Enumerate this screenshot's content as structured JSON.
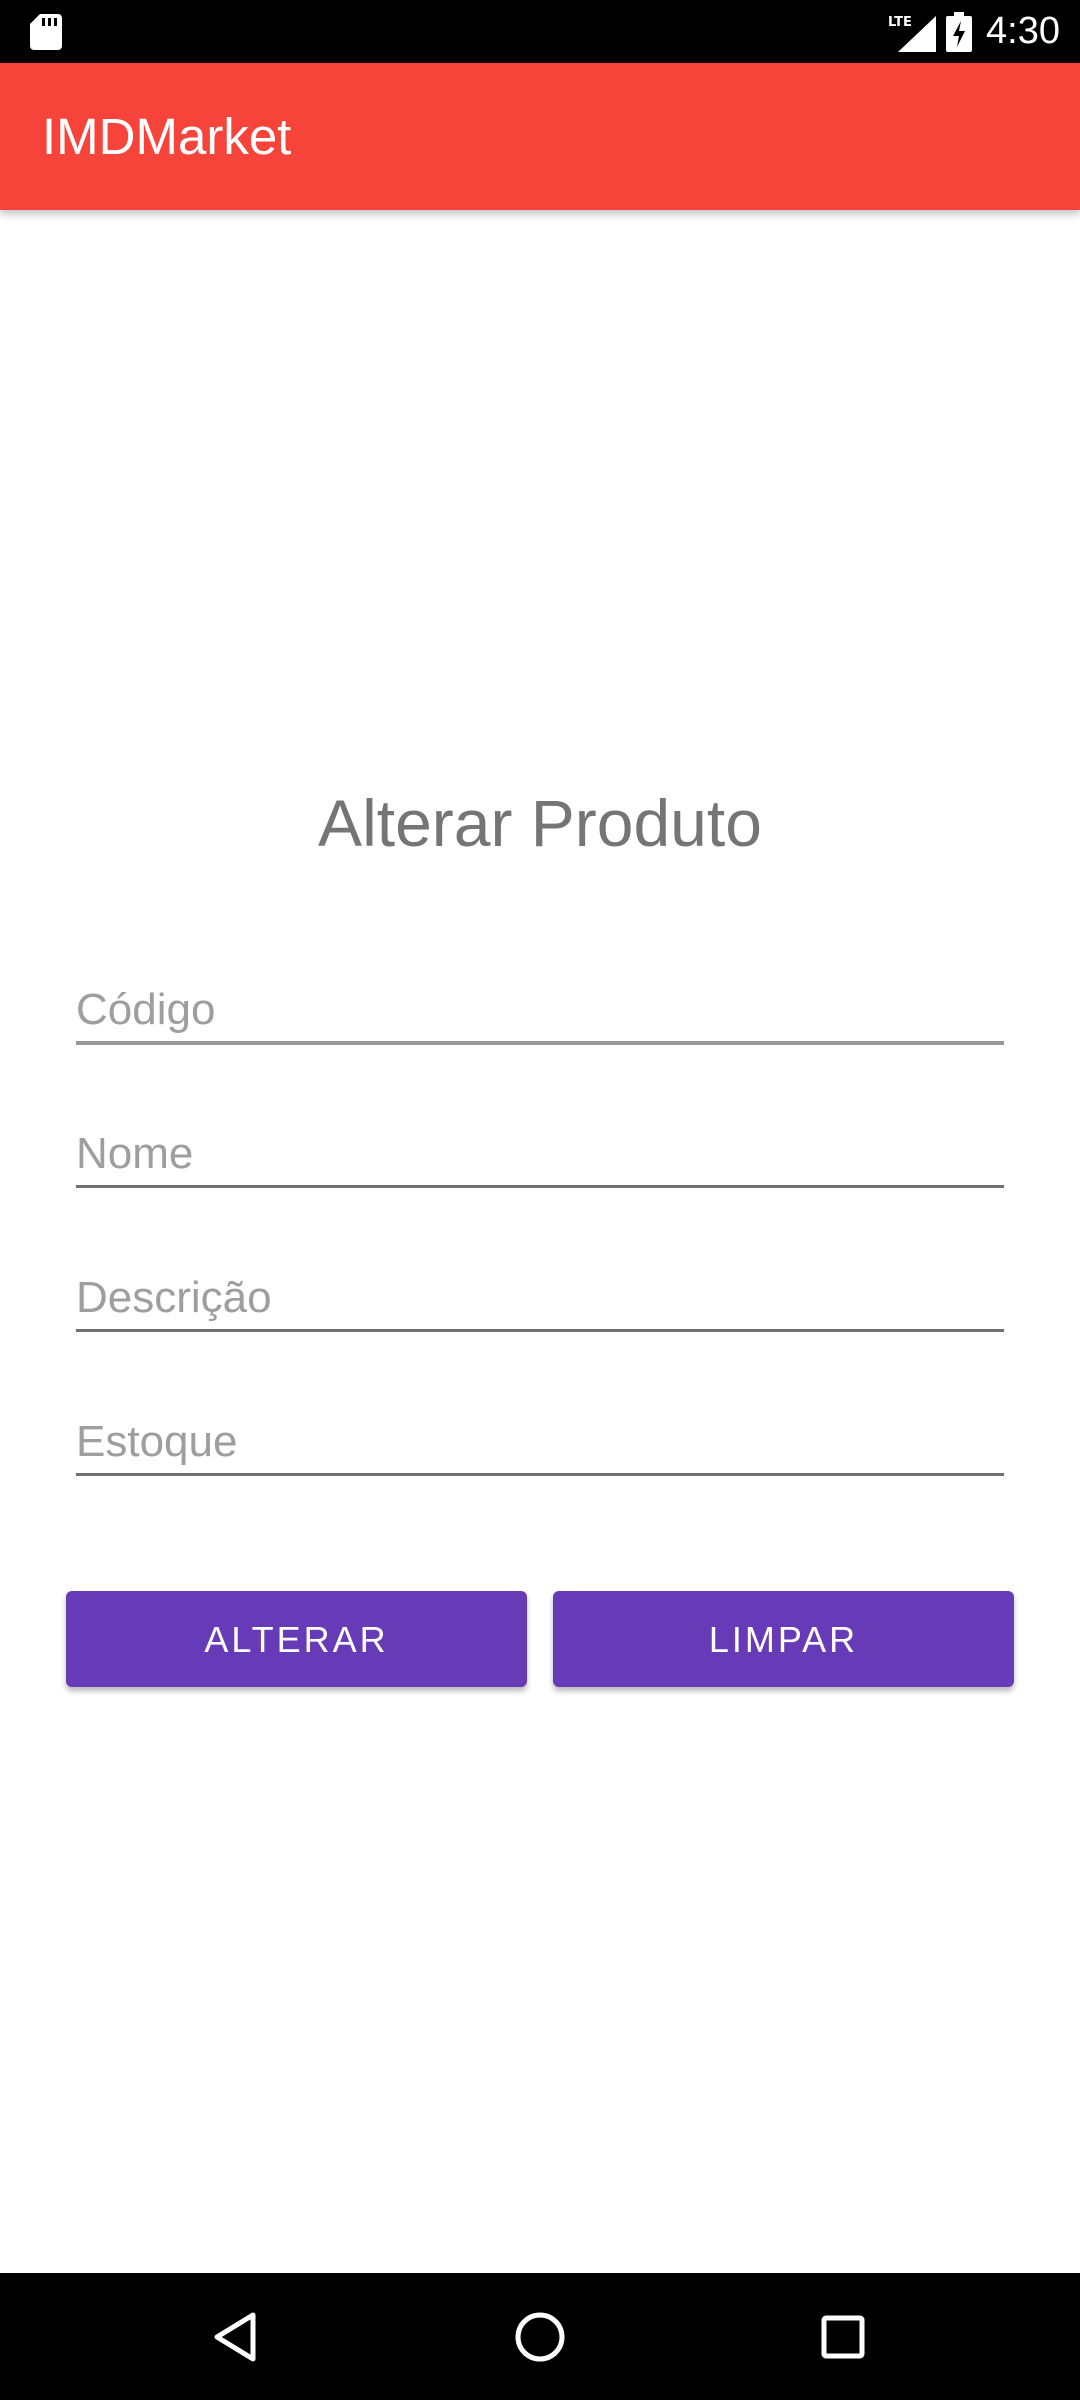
{
  "status_bar": {
    "time": "4:30",
    "network": "LTE",
    "icons": [
      "sd-card-icon",
      "lte-signal-icon",
      "battery-charging-icon"
    ]
  },
  "app_bar": {
    "title": "IMDMarket",
    "color": "#f7443a"
  },
  "form": {
    "heading": "Alterar Produto",
    "fields": [
      {
        "placeholder": "Código",
        "value": ""
      },
      {
        "placeholder": "Nome",
        "value": ""
      },
      {
        "placeholder": "Descrição",
        "value": ""
      },
      {
        "placeholder": "Estoque",
        "value": ""
      }
    ]
  },
  "buttons": {
    "alterar_label": "ALTERAR",
    "limpar_label": "LIMPAR",
    "color": "#673ab7"
  },
  "nav_bar": {
    "icons": [
      "back-icon",
      "home-icon",
      "recents-icon"
    ]
  }
}
